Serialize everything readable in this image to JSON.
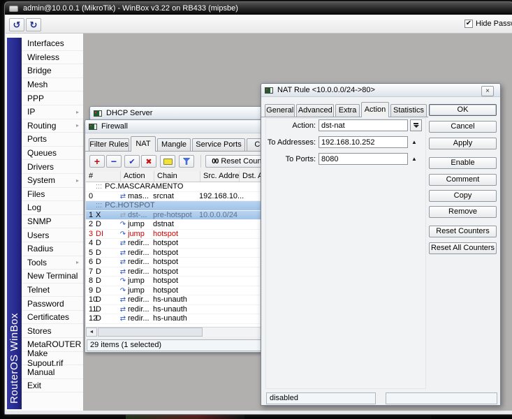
{
  "colors": {
    "selection_blue": "#a9c7ea",
    "invalid_red": "#d40000",
    "brand_blue": "#2b2f9e",
    "titlebar_dark": "#1a1a1a"
  },
  "icons": {
    "undo": "↺",
    "redo": "↻",
    "check": "✔",
    "add": "+",
    "remove": "−",
    "enable_check": "✔",
    "disable_cross": "✖",
    "submenu_arrow": "▸",
    "up_arrow": "▲",
    "left_arrow": "◄",
    "close": "×",
    "jump": "↷",
    "redirect": "⇄"
  },
  "main_window": {
    "title": "admin@10.0.0.1 (MikroTik) - WinBox v3.22 on RB433 (mipsbe)",
    "hide_password_label": "Hide Password",
    "hide_password_checked": true
  },
  "brand": {
    "vertical_label": "RouterOS WinBox"
  },
  "sidebar": {
    "items": [
      {
        "label": "Interfaces",
        "submenu": false
      },
      {
        "label": "Wireless",
        "submenu": false
      },
      {
        "label": "Bridge",
        "submenu": false
      },
      {
        "label": "Mesh",
        "submenu": false
      },
      {
        "label": "PPP",
        "submenu": false
      },
      {
        "label": "IP",
        "submenu": true
      },
      {
        "label": "Routing",
        "submenu": true
      },
      {
        "label": "Ports",
        "submenu": false
      },
      {
        "label": "Queues",
        "submenu": false
      },
      {
        "label": "Drivers",
        "submenu": false
      },
      {
        "label": "System",
        "submenu": true
      },
      {
        "label": "Files",
        "submenu": false
      },
      {
        "label": "Log",
        "submenu": false
      },
      {
        "label": "SNMP",
        "submenu": false
      },
      {
        "label": "Users",
        "submenu": false
      },
      {
        "label": "Radius",
        "submenu": false
      },
      {
        "label": "Tools",
        "submenu": true
      },
      {
        "label": "New Terminal",
        "submenu": false
      },
      {
        "label": "Telnet",
        "submenu": false
      },
      {
        "label": "Password",
        "submenu": false
      },
      {
        "label": "Certificates",
        "submenu": false
      },
      {
        "label": "Stores",
        "submenu": false
      },
      {
        "label": "MetaROUTER",
        "submenu": false
      },
      {
        "label": "Make Supout.rif",
        "submenu": false
      },
      {
        "label": "Manual",
        "submenu": false
      },
      {
        "label": "Exit",
        "submenu": false
      }
    ]
  },
  "dhcp_window": {
    "title": "DHCP Server"
  },
  "firewall": {
    "title": "Firewall",
    "tabs": [
      "Filter Rules",
      "NAT",
      "Mangle",
      "Service Ports",
      "Connections"
    ],
    "active_tab": "NAT",
    "toolbar": {
      "counters_glyph": "00",
      "reset_counters_label": "Reset Counters"
    },
    "columns": [
      "#",
      "Action",
      "Chain",
      "Src. Address",
      "Dst. Address"
    ],
    "comment_prefix": ":::",
    "rows": [
      {
        "type": "comment",
        "text": "PC.MASCARAMENTO",
        "selected": false
      },
      {
        "type": "rule",
        "num": "0",
        "flags": "",
        "icon": "masquerade",
        "action": "mas...",
        "chain": "srcnat",
        "src": "192.168.10...",
        "selected": false,
        "state": "normal"
      },
      {
        "type": "comment",
        "text": "PC.HOTSPOT",
        "selected": true
      },
      {
        "type": "rule",
        "num": "1",
        "flags": "X",
        "icon": "dst-nat",
        "action": "dst-...",
        "chain": "pre-hotspot",
        "src": "10.0.0.0/24",
        "selected": true,
        "state": "disabled"
      },
      {
        "type": "rule",
        "num": "2",
        "flags": "D",
        "icon": "jump",
        "action": "jump",
        "chain": "dstnat",
        "src": "",
        "selected": false,
        "state": "normal"
      },
      {
        "type": "rule",
        "num": "3",
        "flags": "DI",
        "icon": "jump",
        "action": "jump",
        "chain": "hotspot",
        "src": "",
        "selected": false,
        "state": "invalid"
      },
      {
        "type": "rule",
        "num": "4",
        "flags": "D",
        "icon": "redirect",
        "action": "redir...",
        "chain": "hotspot",
        "src": "",
        "selected": false,
        "state": "normal"
      },
      {
        "type": "rule",
        "num": "5",
        "flags": "D",
        "icon": "redirect",
        "action": "redir...",
        "chain": "hotspot",
        "src": "",
        "selected": false,
        "state": "normal"
      },
      {
        "type": "rule",
        "num": "6",
        "flags": "D",
        "icon": "redirect",
        "action": "redir...",
        "chain": "hotspot",
        "src": "",
        "selected": false,
        "state": "normal"
      },
      {
        "type": "rule",
        "num": "7",
        "flags": "D",
        "icon": "redirect",
        "action": "redir...",
        "chain": "hotspot",
        "src": "",
        "selected": false,
        "state": "normal"
      },
      {
        "type": "rule",
        "num": "8",
        "flags": "D",
        "icon": "jump",
        "action": "jump",
        "chain": "hotspot",
        "src": "",
        "selected": false,
        "state": "normal"
      },
      {
        "type": "rule",
        "num": "9",
        "flags": "D",
        "icon": "jump",
        "action": "jump",
        "chain": "hotspot",
        "src": "",
        "selected": false,
        "state": "normal"
      },
      {
        "type": "rule",
        "num": "10",
        "flags": "D",
        "icon": "redirect",
        "action": "redir...",
        "chain": "hs-unauth",
        "src": "",
        "selected": false,
        "state": "normal"
      },
      {
        "type": "rule",
        "num": "11",
        "flags": "D",
        "icon": "redirect",
        "action": "redir...",
        "chain": "hs-unauth",
        "src": "",
        "selected": false,
        "state": "normal"
      },
      {
        "type": "rule",
        "num": "12",
        "flags": "D",
        "icon": "redirect",
        "action": "redir...",
        "chain": "hs-unauth",
        "src": "",
        "selected": false,
        "state": "normal"
      }
    ],
    "status": "29 items (1 selected)"
  },
  "dialog": {
    "title": "NAT Rule <10.0.0.0/24->80>",
    "tabs": [
      "General",
      "Advanced",
      "Extra",
      "Action",
      "Statistics"
    ],
    "active_tab": "Action",
    "fields": [
      {
        "label": "Action:",
        "value": "dst-nat",
        "control": "dropdown"
      },
      {
        "label": "To Addresses:",
        "value": "192.168.10.252",
        "control": "up"
      },
      {
        "label": "To Ports:",
        "value": "8080",
        "control": "up"
      }
    ],
    "buttons": [
      "OK",
      "Cancel",
      "Apply",
      "Enable",
      "Comment",
      "Copy",
      "Remove",
      "Reset Counters",
      "Reset All Counters"
    ],
    "status_left": "disabled"
  }
}
